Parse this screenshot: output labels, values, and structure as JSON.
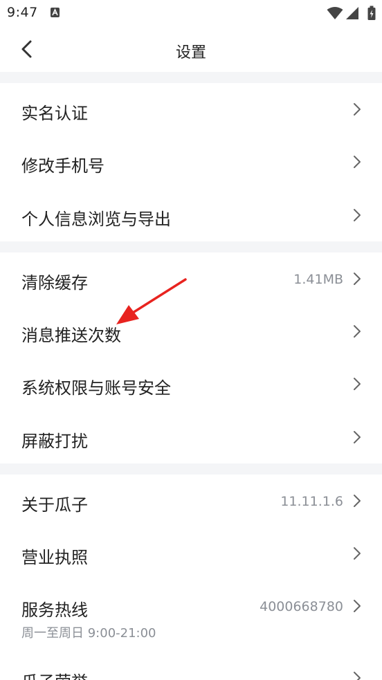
{
  "status_bar": {
    "time": "9:47",
    "icons": [
      "notification-a-icon",
      "wifi-icon",
      "cellular-signal-icon",
      "battery-icon"
    ]
  },
  "header": {
    "title": "设置",
    "back_icon": "chevron-left-icon"
  },
  "groups": [
    {
      "items": [
        {
          "label": "实名认证",
          "value": ""
        },
        {
          "label": "修改手机号",
          "value": ""
        },
        {
          "label": "个人信息浏览与导出",
          "value": ""
        }
      ]
    },
    {
      "items": [
        {
          "label": "清除缓存",
          "value": "1.41MB"
        },
        {
          "label": "消息推送次数",
          "value": ""
        },
        {
          "label": "系统权限与账号安全",
          "value": ""
        },
        {
          "label": "屏蔽打扰",
          "value": ""
        }
      ]
    },
    {
      "items": [
        {
          "label": "关于瓜子",
          "value": "11.11.1.6"
        },
        {
          "label": "营业执照",
          "value": ""
        },
        {
          "label": "服务热线",
          "value": "4000668780",
          "sub": "周一至周日 9:00-21:00"
        },
        {
          "label": "瓜子荣誉",
          "value": ""
        }
      ]
    }
  ],
  "annotation": {
    "color": "#e8231f",
    "icon": "red-arrow-icon"
  },
  "colors": {
    "background": "#ffffff",
    "separator": "#f4f5f7",
    "text_primary": "#222222",
    "text_secondary": "#8b8f96"
  }
}
